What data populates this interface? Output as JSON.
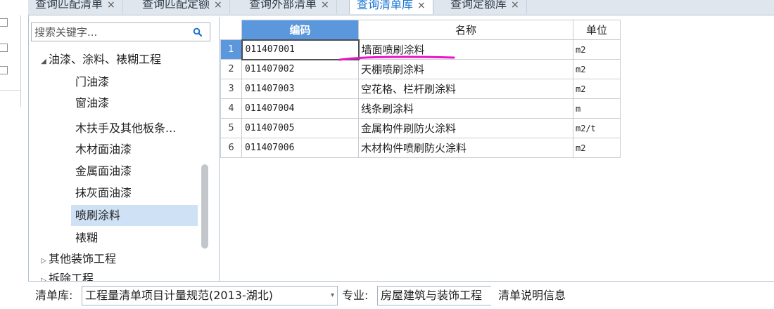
{
  "tabs": [
    {
      "label": "查询匹配清单",
      "close": "×",
      "active": false
    },
    {
      "label": "查询匹配定额",
      "close": "×",
      "active": false
    },
    {
      "label": "查询外部清单",
      "close": "×",
      "active": false
    },
    {
      "label": "查询清单库",
      "close": "×",
      "active": true
    },
    {
      "label": "查询定额库",
      "close": "×",
      "active": false
    }
  ],
  "search": {
    "placeholder": "搜索关键字...",
    "icon": "search-icon"
  },
  "tree": {
    "items": [
      {
        "label": "油漆、涂料、裱糊工程",
        "expander": "◢",
        "level": 0,
        "selected": false
      },
      {
        "label": "门油漆",
        "level": 1,
        "selected": false
      },
      {
        "label": "窗油漆",
        "level": 1,
        "selected": false
      },
      {
        "label": "木扶手及其他板条...",
        "level": 1,
        "selected": false
      },
      {
        "label": "木材面油漆",
        "level": 1,
        "selected": false
      },
      {
        "label": "金属面油漆",
        "level": 1,
        "selected": false
      },
      {
        "label": "抹灰面油漆",
        "level": 1,
        "selected": false
      },
      {
        "label": "喷刷涂料",
        "level": 1,
        "selected": true
      },
      {
        "label": "裱糊",
        "level": 1,
        "selected": false
      },
      {
        "label": "其他装饰工程",
        "expander": "▷",
        "level": 0,
        "selected": false
      },
      {
        "label": "拆除工程",
        "expander": "▷",
        "level": 0,
        "selected": false
      }
    ]
  },
  "grid": {
    "headers": {
      "code": "编码",
      "name": "名称",
      "unit": "单位"
    },
    "rows": [
      {
        "idx": "1",
        "code": "011407001",
        "name": "墙面喷刷涂料",
        "unit": "m2"
      },
      {
        "idx": "2",
        "code": "011407002",
        "name": "天棚喷刷涂料",
        "unit": "m2"
      },
      {
        "idx": "3",
        "code": "011407003",
        "name": "空花格、栏杆刷涂料",
        "unit": "m2"
      },
      {
        "idx": "4",
        "code": "011407004",
        "name": "线条刷涂料",
        "unit": "m"
      },
      {
        "idx": "5",
        "code": "011407005",
        "name": "金属构件刷防火涂料",
        "unit": "m2/t"
      },
      {
        "idx": "6",
        "code": "011407006",
        "name": "木材构件喷刷防火涂料",
        "unit": "m2"
      }
    ],
    "current_row": 1,
    "annotation_color": "#e815c8"
  },
  "bottom": {
    "library_label": "清单库:",
    "library_value": "工程量清单项目计量规范(2013-湖北)",
    "specialty_label": "专业:",
    "specialty_value": "房屋建筑与装饰工程",
    "dropdown_glyph": "▾",
    "info_button": "清单说明信息"
  },
  "colors": {
    "accent": "#5b97dc",
    "selection": "#cfe1f5",
    "tab_active_text": "#1976d2"
  }
}
